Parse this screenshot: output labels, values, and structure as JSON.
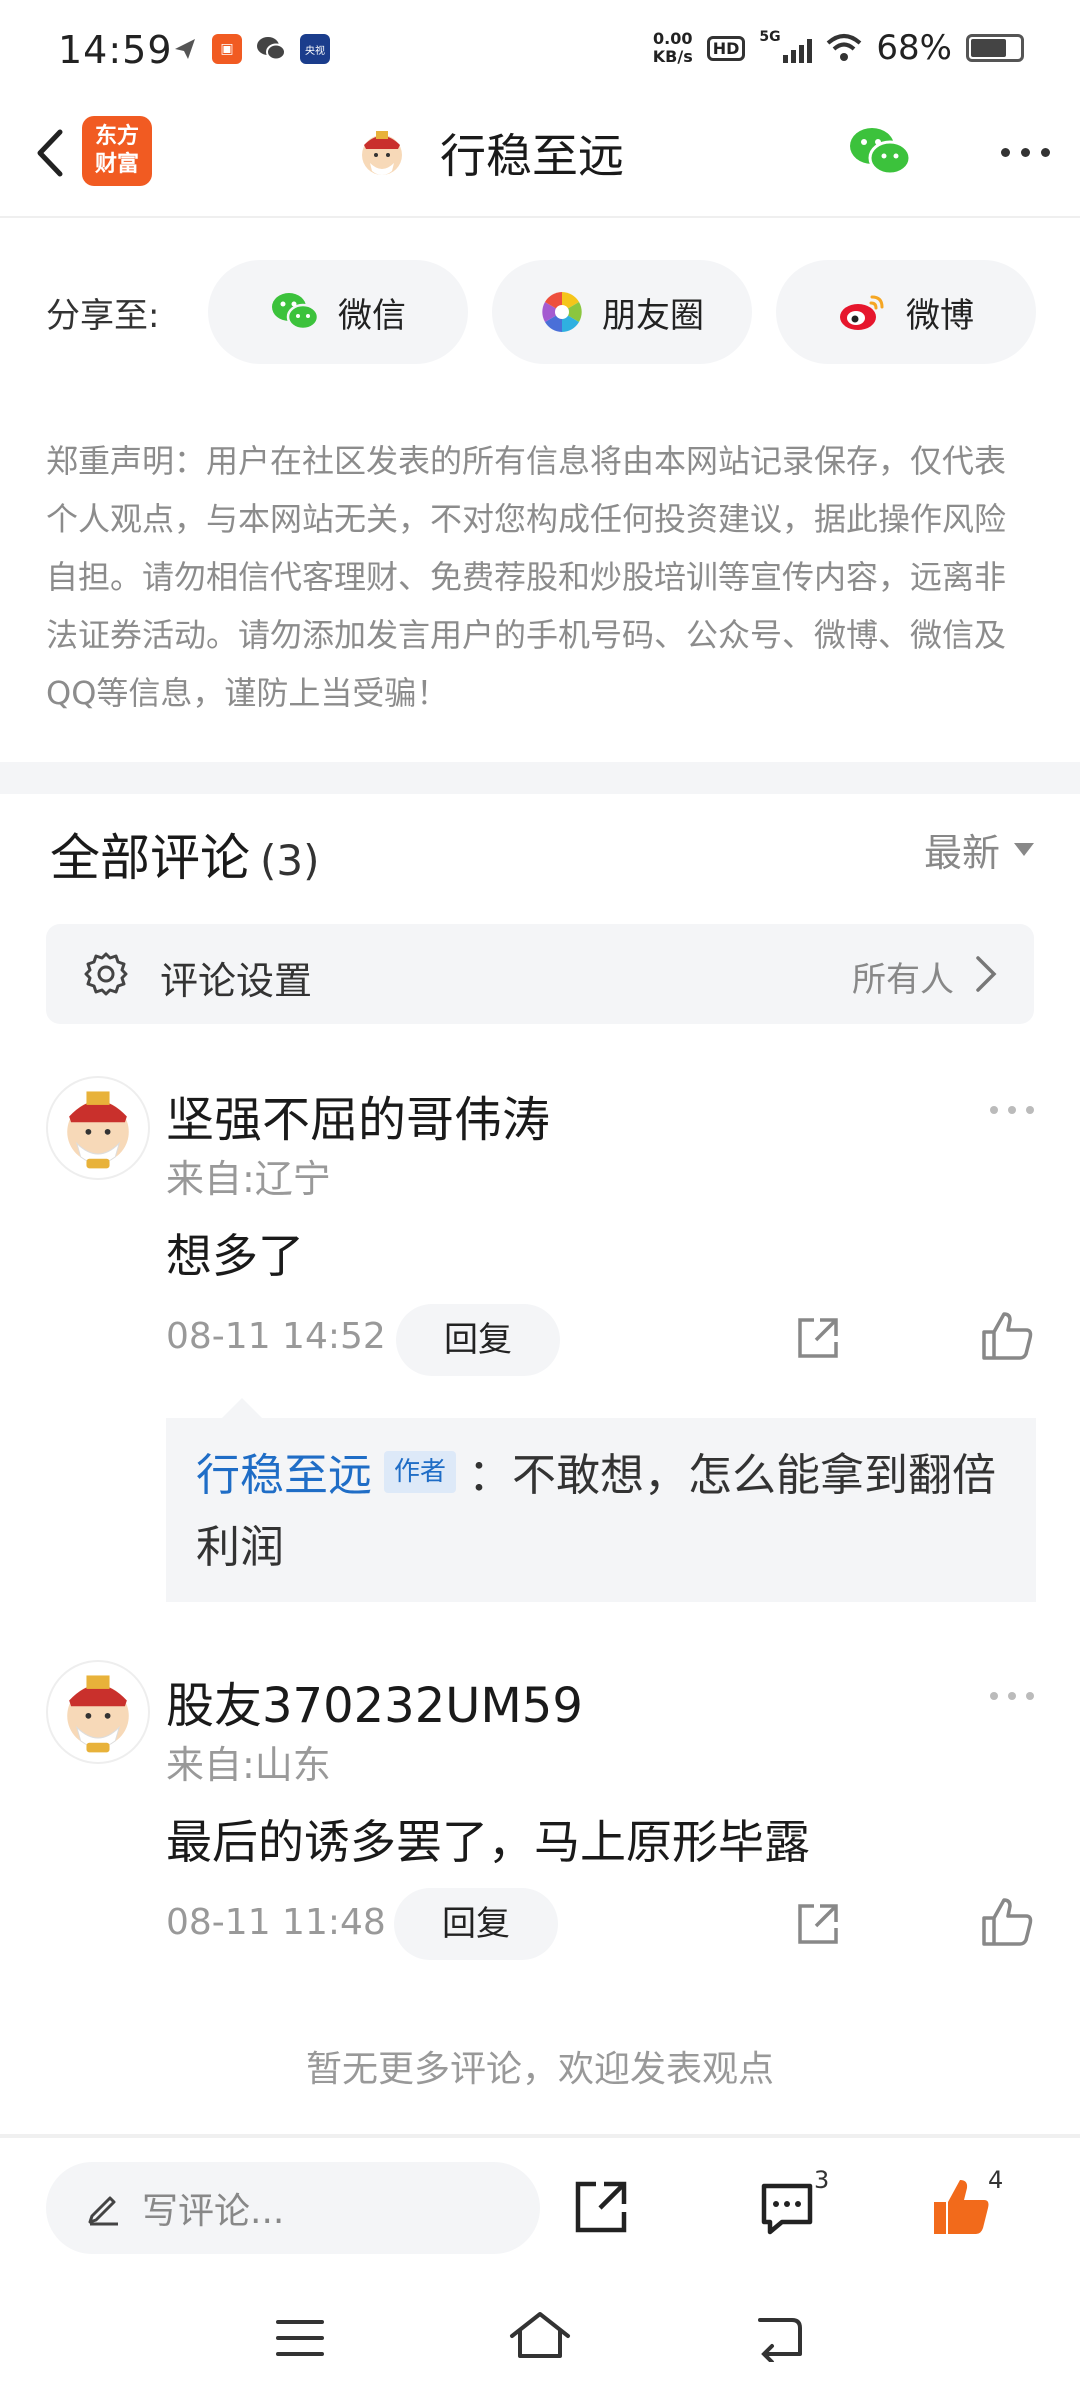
{
  "status_bar": {
    "time": "14:59",
    "net_speed_value": "0.00",
    "net_speed_unit": "KB/s",
    "hd": "HD",
    "network": "5G",
    "battery": "68%",
    "battery_level": 0.68
  },
  "header": {
    "logo_text_line1": "东方",
    "logo_text_line2": "财富",
    "title": "行稳至远"
  },
  "share": {
    "label": "分享至:",
    "buttons": [
      {
        "label": "微信",
        "icon": "wechat-icon"
      },
      {
        "label": "朋友圈",
        "icon": "moments-icon"
      },
      {
        "label": "微博",
        "icon": "weibo-icon"
      }
    ]
  },
  "disclaimer": "郑重声明：用户在社区发表的所有信息将由本网站记录保存，仅代表个人观点，与本网站无关，不对您构成任何投资建议，据此操作风险自担。请勿相信代客理财、免费荐股和炒股培训等宣传内容，远离非法证券活动。请勿添加发言用户的手机号码、公众号、微博、微信及QQ等信息，谨防上当受骗！",
  "comments_header": {
    "title": "全部评论",
    "count": "(3)",
    "sort": "最新"
  },
  "settings": {
    "label": "评论设置",
    "value": "所有人"
  },
  "comments": [
    {
      "name": "坚强不屈的哥伟涛",
      "from": "来自:辽宁",
      "text": "想多了",
      "time": "08-11 14:52",
      "reply_label": "回复",
      "reply": {
        "author": "行稳至远",
        "tag": "作者",
        "text": "：不敢想，怎么能拿到翻倍利润"
      }
    },
    {
      "name": "股友370232UM59",
      "from": "来自:山东",
      "text": "最后的诱多罢了，马上原形毕露",
      "time": "08-11 11:48",
      "reply_label": "回复"
    }
  ],
  "no_more": "暂无更多评论，欢迎发表观点",
  "bottom_bar": {
    "write_placeholder": "写评论...",
    "comment_count": "3",
    "like_count": "4"
  },
  "colors": {
    "brand": "#f15b22",
    "link": "#1f6dc6",
    "like": "#f26a1b",
    "wechat": "#3cc23c"
  }
}
